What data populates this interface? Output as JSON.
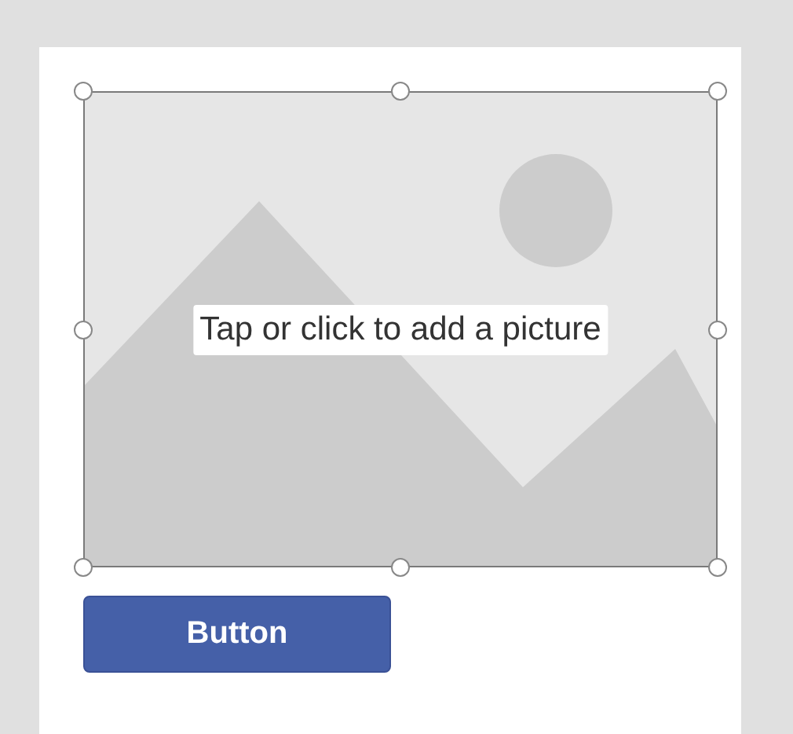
{
  "image_control": {
    "prompt": "Tap or click to add a picture",
    "selected": true
  },
  "button": {
    "label": "Button"
  }
}
